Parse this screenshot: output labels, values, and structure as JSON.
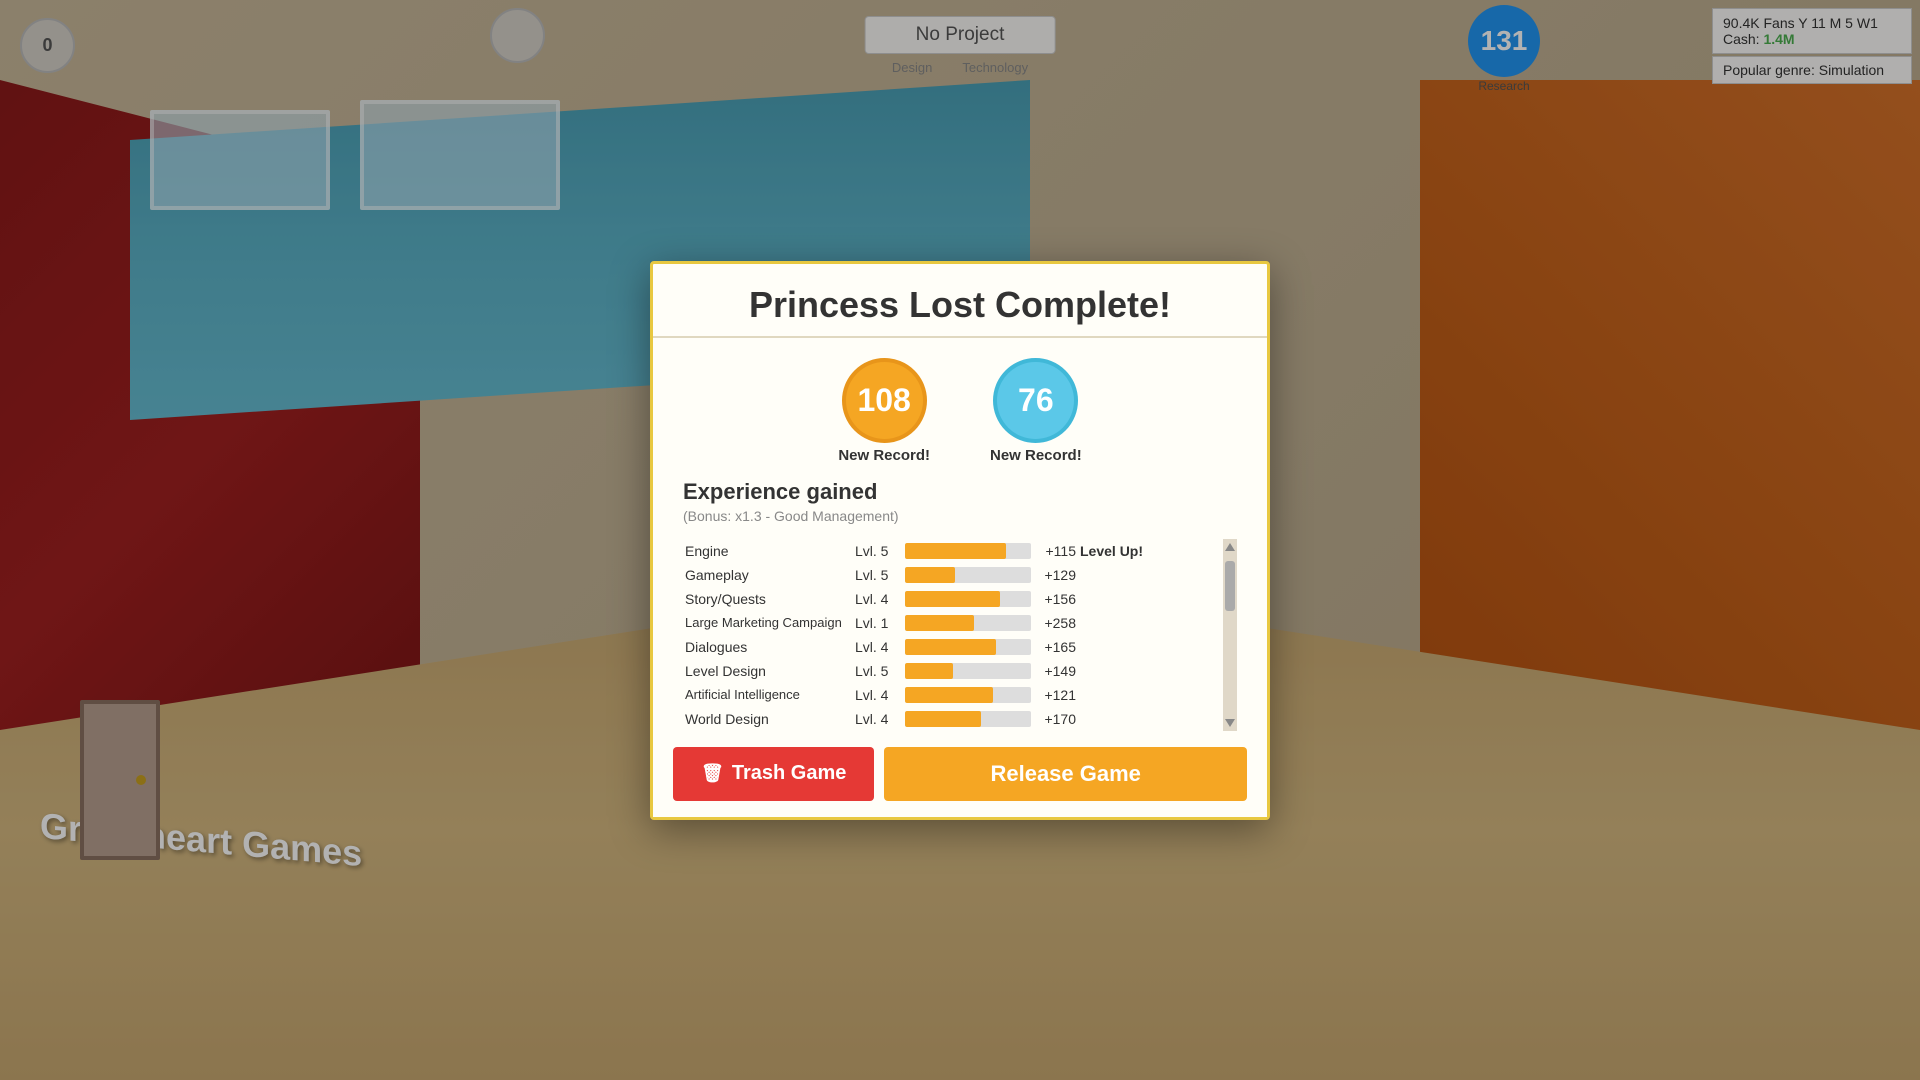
{
  "hud": {
    "counter": "0",
    "project_name": "No Project",
    "design_label": "Design",
    "technology_label": "Technology",
    "research_count": "131",
    "research_label": "Research"
  },
  "stats": {
    "fans_line": "90.4K Fans Y 11 M 5 W1",
    "cash_label": "Cash:",
    "cash_value": "1.4M",
    "genre_label": "Popular genre: Simulation"
  },
  "modal": {
    "title": "Princess Lost Complete!",
    "score_orange": "108",
    "score_blue": "76",
    "record_label_1": "New Record!",
    "record_label_2": "New Record!",
    "exp_title": "Experience gained",
    "exp_bonus": "(Bonus: x1.3 - Good Management)",
    "skills": [
      {
        "name": "Engine",
        "level": "Lvl. 5",
        "fill_pct": 80,
        "plus": "+115",
        "levelup": "Level Up!"
      },
      {
        "name": "Gameplay",
        "level": "Lvl. 5",
        "fill_pct": 40,
        "plus": "+129",
        "levelup": ""
      },
      {
        "name": "Story/Quests",
        "level": "Lvl. 4",
        "fill_pct": 75,
        "plus": "+156",
        "levelup": ""
      },
      {
        "name": "Large Marketing Campaign",
        "level": "Lvl. 1",
        "fill_pct": 55,
        "plus": "+258",
        "levelup": ""
      },
      {
        "name": "Dialogues",
        "level": "Lvl. 4",
        "fill_pct": 72,
        "plus": "+165",
        "levelup": ""
      },
      {
        "name": "Level Design",
        "level": "Lvl. 5",
        "fill_pct": 38,
        "plus": "+149",
        "levelup": ""
      },
      {
        "name": "Artificial Intelligence",
        "level": "Lvl. 4",
        "fill_pct": 70,
        "plus": "+121",
        "levelup": ""
      },
      {
        "name": "World Design",
        "level": "Lvl. 4",
        "fill_pct": 60,
        "plus": "+170",
        "levelup": ""
      }
    ],
    "btn_trash": "Trash Game",
    "btn_release": "Release Game"
  },
  "company": {
    "name": "Greenheart Games"
  },
  "colors": {
    "orange_score": "#f5a623",
    "blue_score": "#5bc8e8",
    "research_blue": "#2196F3",
    "bar_orange": "#f5a623",
    "btn_trash": "#e53935",
    "btn_release": "#f5a623",
    "cash_green": "#4caf50"
  }
}
